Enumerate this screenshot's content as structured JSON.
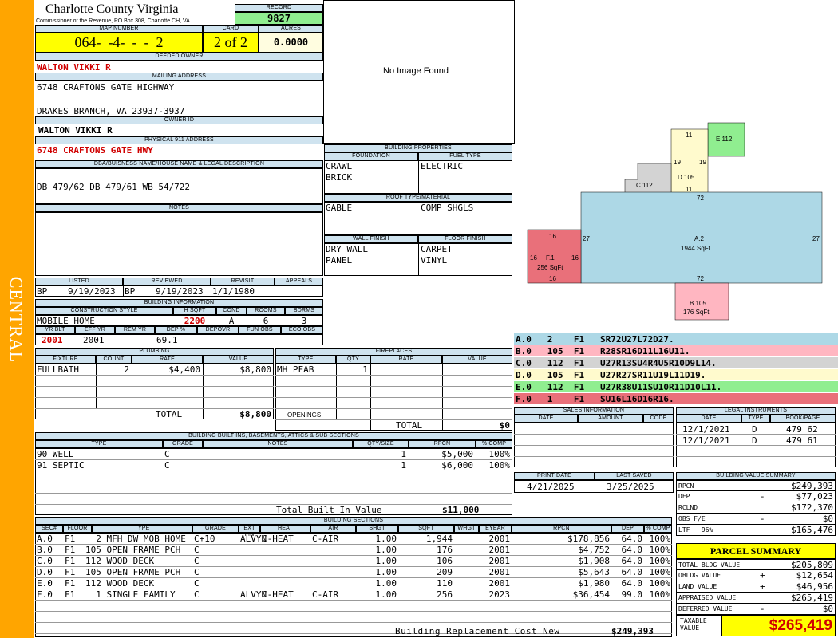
{
  "side_label": "CENTRAL",
  "county": {
    "name": "Charlotte County Virginia",
    "subtitle": "Commissioner of the Revenue, PO Box 308, Charlotte CH, VA"
  },
  "record": {
    "label": "RECORD",
    "value": "9827"
  },
  "map": {
    "label": "MAP NUMBER",
    "value": "064-  -4-  -  -  2"
  },
  "card": {
    "label": "CARD",
    "value": "2 of 2"
  },
  "acres": {
    "label": "ACRES",
    "value": "0.0000"
  },
  "deeded": {
    "label": "DEEDED OWNER",
    "value": "WALTON VIKKI R"
  },
  "mailing": {
    "label": "MAILING ADDRESS",
    "line1": "6748 CRAFTONS GATE HIGHWAY",
    "line2": "DRAKES BRANCH, VA 23937-3937"
  },
  "owner_id": {
    "label": "OWNER ID",
    "value": "WALTON VIKKI R"
  },
  "physical": {
    "label": "PHYSICAL 911 ADDRESS",
    "value": "6748 CRAFTONS GATE HWY"
  },
  "dba": {
    "label": "DBA/BUISNESS NAME/HOUSE NAME & LEGAL DESCRIPTION",
    "value": "DB 479/62 DB 479/61 WB 54/722"
  },
  "notes": {
    "label": "NOTES"
  },
  "no_image": "No Image Found",
  "bp": {
    "label": "BUILDING PROPERTIES",
    "foundation_label": "FOUNDATION",
    "fuel_label": "FUEL TYPE",
    "foundation1": "CRAWL",
    "foundation2": "BRICK",
    "fuel": "ELECTRIC",
    "roof_label": "ROOF TYPE/MATERIAL",
    "roof_type": "GABLE",
    "roof_mat": "COMP SHGLS",
    "wall_label": "WALL FINISH",
    "floor_label": "FLOOR FINISH",
    "wall1": "DRY WALL",
    "wall2": "PANEL",
    "floor1": "CARPET",
    "floor2": "VINYL"
  },
  "status": {
    "listed_label": "LISTED",
    "reviewed_label": "REVIEWED",
    "revisit_label": "REVISIT",
    "appeals_label": "APPEALS",
    "listed_by": "BP",
    "listed": "9/19/2023",
    "reviewed_by": "BP",
    "reviewed": "9/19/2023",
    "revisit": "1/1/1980"
  },
  "bi": {
    "label": "BUILDING INFORMATION",
    "style_label": "CONSTRUCTION STYLE",
    "hsqft_label": "H SQFT",
    "cond_label": "COND",
    "rooms_label": "ROOMS",
    "bdrms_label": "BDRMS",
    "style": "MOBILE HOME",
    "hsqft": "2200",
    "cond": "A",
    "rooms": "6",
    "bdrms": "3",
    "yrblt_label": "YR BLT",
    "effyr_label": "EFF YR",
    "remyr_label": "REM YR",
    "dep_label": "DEP %",
    "depovr_label": "DEPOVR",
    "funobs_label": "FUN OBS",
    "ecoobs_label": "ECO OBS",
    "yrblt": "2001",
    "effyr": "2001",
    "dep": "69.1"
  },
  "plumbing": {
    "label": "PLUMBING",
    "cols": [
      "FIXTURE",
      "COUNT",
      "RATE",
      "VALUE"
    ],
    "row": [
      "FULLBATH",
      "2",
      "$4,400",
      "$8,800"
    ],
    "total_label": "TOTAL",
    "total": "$8,800"
  },
  "fireplaces": {
    "label": "FIREPLACES",
    "cols": [
      "TYPE",
      "QTY",
      "RATE",
      "VALUE"
    ],
    "row": [
      "MH PFAB",
      "1"
    ],
    "openings_label": "OPENINGS",
    "total_label": "TOTAL",
    "total": "$0"
  },
  "builtins": {
    "label": "BUILDING BUILT INS, BASEMENTS, ATTICS & SUB SECTIONS",
    "cols": [
      "TYPE",
      "GRADE",
      "NOTES",
      "QTY/SIZE",
      "RPCN",
      "% COMP"
    ],
    "rows": [
      [
        "90 WELL",
        "C",
        "1",
        "$5,000",
        "100%"
      ],
      [
        "91 SEPTIC",
        "C",
        "1",
        "$6,000",
        "100%"
      ]
    ],
    "total_label": "Total Built In Value",
    "total": "$11,000"
  },
  "sketch": {
    "labels": {
      "a": "A.2",
      "a_sq": "1944 SqFt",
      "a_top": "72",
      "a_bot": "72",
      "a_l": "27",
      "a_r": "27",
      "b": "B.105",
      "b_sq": "176 SqFt",
      "c": "C.112",
      "d": "D.105",
      "d_t": "11",
      "d_l": "19",
      "d_r": "19",
      "d_b": "11",
      "e": "E.112",
      "f": "F.1",
      "f_sq": "256 SqFt",
      "f16": "16"
    }
  },
  "sections_list": [
    {
      "text": "A.0   2    F1   SR72U27L72D27.",
      "color": "#add8e6"
    },
    {
      "text": "B.0   105  F1   R28SR16D11L16U11.",
      "color": "#ffb6c1"
    },
    {
      "text": "C.0   112  F1   U27R13SU4R4U5R10D9L14.",
      "color": "#d3d3d3"
    },
    {
      "text": "D.0   105  F1   U27R27SR11U19L11D19.",
      "color": "#fffacd"
    },
    {
      "text": "E.0   112  F1   U27R38U11SU10R11D10L11.",
      "color": "#90ee90"
    },
    {
      "text": "F.0   1    F1   SU16L16D16R16.",
      "color": "#e9707a"
    }
  ],
  "sales": {
    "label": "SALES INFORMATION",
    "cols": [
      "DATE",
      "AMOUNT",
      "CODE"
    ]
  },
  "legal": {
    "label": "LEGAL INSTRUMENTS",
    "cols": [
      "DATE",
      "TYPE",
      "BOOK/PAGE"
    ],
    "rows": [
      [
        "12/1/2021",
        "D",
        "479 62"
      ],
      [
        "12/1/2021",
        "D",
        "479 61"
      ]
    ]
  },
  "print": {
    "date_label": "PRINT DATE",
    "saved_label": "LAST SAVED",
    "date": "4/21/2025",
    "saved": "3/25/2025"
  },
  "bvs": {
    "label": "BUILDING VALUE SUMMARY",
    "rows": [
      [
        "RPCN",
        "",
        "$249,393"
      ],
      [
        "DEP",
        "-",
        "$77,023"
      ],
      [
        "RCLND",
        "",
        "$172,370"
      ],
      [
        "OBS F/E",
        "-",
        "$0"
      ],
      [
        "LTF   96%",
        "",
        "$165,476"
      ]
    ]
  },
  "parcel": {
    "label": "PARCEL SUMMARY",
    "rows": [
      [
        "TOTAL BLDG VALUE",
        "",
        "$205,809"
      ],
      [
        "OBLDG VALUE",
        "+",
        "$12,654"
      ],
      [
        "LAND VALUE",
        "+",
        "$46,956"
      ],
      [
        "APPRAISED VALUE",
        "",
        "$265,419"
      ],
      [
        "DEFERRED VALUE",
        "-",
        "$0"
      ]
    ],
    "taxable_label": "TAXABLE VALUE",
    "taxable": "$265,419"
  },
  "bs": {
    "label": "BUILDING SECTIONS",
    "cols": [
      "SEC#",
      "FLOOR",
      "TYPE",
      "GRADE",
      "EXT FIN",
      "HEAT",
      "AIR",
      "SHGT",
      "SQFT",
      "WHGT",
      "EYEAR",
      "RPCN",
      "DEP",
      "% COMP"
    ],
    "rows": [
      [
        "A.0",
        "F1",
        "2 MFH DW MOB HOME",
        "C+10",
        "ALVYN",
        "C-HEAT",
        "C-AIR",
        "1.00",
        "1,944",
        "",
        "2001",
        "$178,856",
        "64.0",
        "100%"
      ],
      [
        "B.0",
        "F1",
        "105 OPEN FRAME PCH",
        "C",
        "",
        "",
        "",
        "1.00",
        "176",
        "",
        "2001",
        "$4,752",
        "64.0",
        "100%"
      ],
      [
        "C.0",
        "F1",
        "112 WOOD DECK",
        "C",
        "",
        "",
        "",
        "1.00",
        "106",
        "",
        "2001",
        "$1,908",
        "64.0",
        "100%"
      ],
      [
        "D.0",
        "F1",
        "105 OPEN FRAME PCH",
        "C",
        "",
        "",
        "",
        "1.00",
        "209",
        "",
        "2001",
        "$5,643",
        "64.0",
        "100%"
      ],
      [
        "E.0",
        "F1",
        "112 WOOD DECK",
        "C",
        "",
        "",
        "",
        "1.00",
        "110",
        "",
        "2001",
        "$1,980",
        "64.0",
        "100%"
      ],
      [
        "F.0",
        "F1",
        "1 SINGLE FAMILY",
        "C",
        "ALVYN",
        "C-HEAT",
        "C-AIR",
        "1.00",
        "256",
        "",
        "2023",
        "$36,454",
        "99.0",
        "100%"
      ]
    ],
    "total_label": "Building Replacement Cost New",
    "total": "$249,393"
  },
  "colors": {
    "side": "#ffa500",
    "header": "#cfe3ef",
    "yellow": "#ffff00",
    "green": "#90ee90",
    "red": "#d00000"
  }
}
